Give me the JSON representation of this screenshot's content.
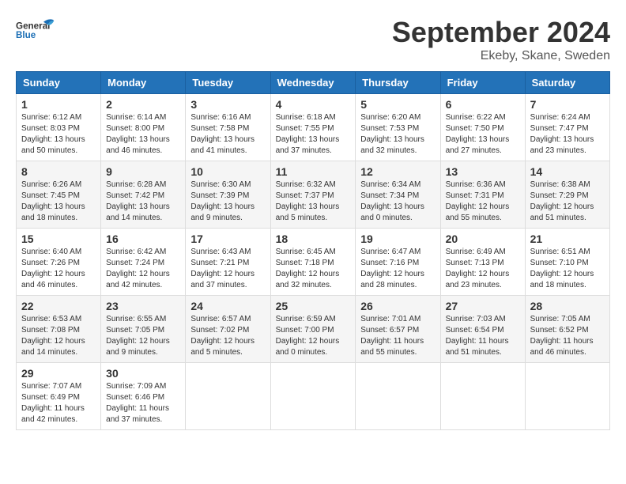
{
  "header": {
    "logo_general": "General",
    "logo_blue": "Blue",
    "month": "September 2024",
    "location": "Ekeby, Skane, Sweden"
  },
  "days_of_week": [
    "Sunday",
    "Monday",
    "Tuesday",
    "Wednesday",
    "Thursday",
    "Friday",
    "Saturday"
  ],
  "weeks": [
    [
      {
        "day": "1",
        "sunrise": "Sunrise: 6:12 AM",
        "sunset": "Sunset: 8:03 PM",
        "daylight": "Daylight: 13 hours and 50 minutes."
      },
      {
        "day": "2",
        "sunrise": "Sunrise: 6:14 AM",
        "sunset": "Sunset: 8:00 PM",
        "daylight": "Daylight: 13 hours and 46 minutes."
      },
      {
        "day": "3",
        "sunrise": "Sunrise: 6:16 AM",
        "sunset": "Sunset: 7:58 PM",
        "daylight": "Daylight: 13 hours and 41 minutes."
      },
      {
        "day": "4",
        "sunrise": "Sunrise: 6:18 AM",
        "sunset": "Sunset: 7:55 PM",
        "daylight": "Daylight: 13 hours and 37 minutes."
      },
      {
        "day": "5",
        "sunrise": "Sunrise: 6:20 AM",
        "sunset": "Sunset: 7:53 PM",
        "daylight": "Daylight: 13 hours and 32 minutes."
      },
      {
        "day": "6",
        "sunrise": "Sunrise: 6:22 AM",
        "sunset": "Sunset: 7:50 PM",
        "daylight": "Daylight: 13 hours and 27 minutes."
      },
      {
        "day": "7",
        "sunrise": "Sunrise: 6:24 AM",
        "sunset": "Sunset: 7:47 PM",
        "daylight": "Daylight: 13 hours and 23 minutes."
      }
    ],
    [
      {
        "day": "8",
        "sunrise": "Sunrise: 6:26 AM",
        "sunset": "Sunset: 7:45 PM",
        "daylight": "Daylight: 13 hours and 18 minutes."
      },
      {
        "day": "9",
        "sunrise": "Sunrise: 6:28 AM",
        "sunset": "Sunset: 7:42 PM",
        "daylight": "Daylight: 13 hours and 14 minutes."
      },
      {
        "day": "10",
        "sunrise": "Sunrise: 6:30 AM",
        "sunset": "Sunset: 7:39 PM",
        "daylight": "Daylight: 13 hours and 9 minutes."
      },
      {
        "day": "11",
        "sunrise": "Sunrise: 6:32 AM",
        "sunset": "Sunset: 7:37 PM",
        "daylight": "Daylight: 13 hours and 5 minutes."
      },
      {
        "day": "12",
        "sunrise": "Sunrise: 6:34 AM",
        "sunset": "Sunset: 7:34 PM",
        "daylight": "Daylight: 13 hours and 0 minutes."
      },
      {
        "day": "13",
        "sunrise": "Sunrise: 6:36 AM",
        "sunset": "Sunset: 7:31 PM",
        "daylight": "Daylight: 12 hours and 55 minutes."
      },
      {
        "day": "14",
        "sunrise": "Sunrise: 6:38 AM",
        "sunset": "Sunset: 7:29 PM",
        "daylight": "Daylight: 12 hours and 51 minutes."
      }
    ],
    [
      {
        "day": "15",
        "sunrise": "Sunrise: 6:40 AM",
        "sunset": "Sunset: 7:26 PM",
        "daylight": "Daylight: 12 hours and 46 minutes."
      },
      {
        "day": "16",
        "sunrise": "Sunrise: 6:42 AM",
        "sunset": "Sunset: 7:24 PM",
        "daylight": "Daylight: 12 hours and 42 minutes."
      },
      {
        "day": "17",
        "sunrise": "Sunrise: 6:43 AM",
        "sunset": "Sunset: 7:21 PM",
        "daylight": "Daylight: 12 hours and 37 minutes."
      },
      {
        "day": "18",
        "sunrise": "Sunrise: 6:45 AM",
        "sunset": "Sunset: 7:18 PM",
        "daylight": "Daylight: 12 hours and 32 minutes."
      },
      {
        "day": "19",
        "sunrise": "Sunrise: 6:47 AM",
        "sunset": "Sunset: 7:16 PM",
        "daylight": "Daylight: 12 hours and 28 minutes."
      },
      {
        "day": "20",
        "sunrise": "Sunrise: 6:49 AM",
        "sunset": "Sunset: 7:13 PM",
        "daylight": "Daylight: 12 hours and 23 minutes."
      },
      {
        "day": "21",
        "sunrise": "Sunrise: 6:51 AM",
        "sunset": "Sunset: 7:10 PM",
        "daylight": "Daylight: 12 hours and 18 minutes."
      }
    ],
    [
      {
        "day": "22",
        "sunrise": "Sunrise: 6:53 AM",
        "sunset": "Sunset: 7:08 PM",
        "daylight": "Daylight: 12 hours and 14 minutes."
      },
      {
        "day": "23",
        "sunrise": "Sunrise: 6:55 AM",
        "sunset": "Sunset: 7:05 PM",
        "daylight": "Daylight: 12 hours and 9 minutes."
      },
      {
        "day": "24",
        "sunrise": "Sunrise: 6:57 AM",
        "sunset": "Sunset: 7:02 PM",
        "daylight": "Daylight: 12 hours and 5 minutes."
      },
      {
        "day": "25",
        "sunrise": "Sunrise: 6:59 AM",
        "sunset": "Sunset: 7:00 PM",
        "daylight": "Daylight: 12 hours and 0 minutes."
      },
      {
        "day": "26",
        "sunrise": "Sunrise: 7:01 AM",
        "sunset": "Sunset: 6:57 PM",
        "daylight": "Daylight: 11 hours and 55 minutes."
      },
      {
        "day": "27",
        "sunrise": "Sunrise: 7:03 AM",
        "sunset": "Sunset: 6:54 PM",
        "daylight": "Daylight: 11 hours and 51 minutes."
      },
      {
        "day": "28",
        "sunrise": "Sunrise: 7:05 AM",
        "sunset": "Sunset: 6:52 PM",
        "daylight": "Daylight: 11 hours and 46 minutes."
      }
    ],
    [
      {
        "day": "29",
        "sunrise": "Sunrise: 7:07 AM",
        "sunset": "Sunset: 6:49 PM",
        "daylight": "Daylight: 11 hours and 42 minutes."
      },
      {
        "day": "30",
        "sunrise": "Sunrise: 7:09 AM",
        "sunset": "Sunset: 6:46 PM",
        "daylight": "Daylight: 11 hours and 37 minutes."
      },
      null,
      null,
      null,
      null,
      null
    ]
  ]
}
